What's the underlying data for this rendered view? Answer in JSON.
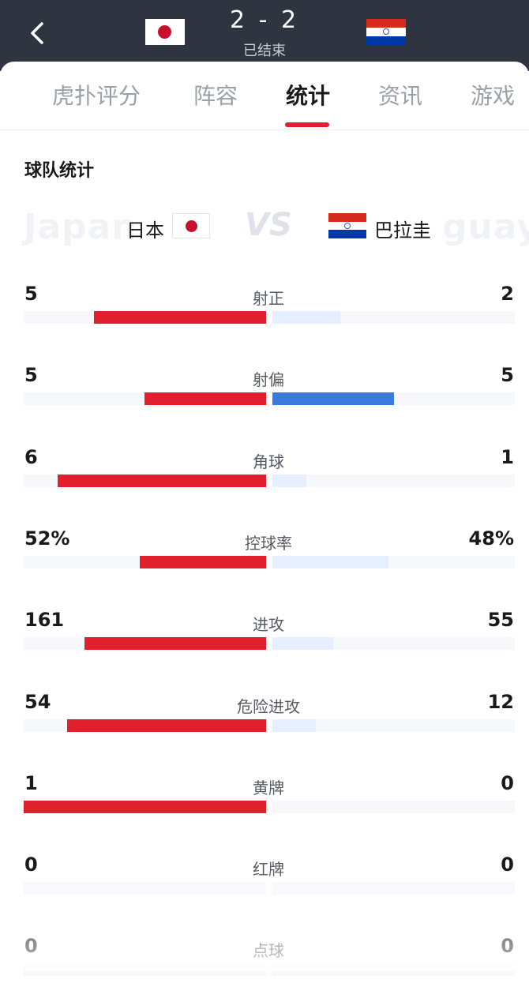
{
  "header": {
    "score": "2 - 2",
    "status": "已结束",
    "home_flag_icon": "japan-flag-icon",
    "away_flag_icon": "paraguay-flag-icon"
  },
  "tabs": [
    {
      "label": "虎扑评分",
      "active": false
    },
    {
      "label": "阵容",
      "active": false
    },
    {
      "label": "统计",
      "active": true
    },
    {
      "label": "资讯",
      "active": false
    },
    {
      "label": "游戏",
      "active": false
    }
  ],
  "section": {
    "title": "球队统计",
    "vs": "VS",
    "home_team": "日本",
    "away_team": "巴拉圭",
    "home_ghost": "Japan",
    "away_ghost": "guay"
  },
  "colors": {
    "accent_red": "#e0202c",
    "accent_blue": "#3b7be0",
    "faded_blue": "#e6efff",
    "header_bg": "#2f3540"
  },
  "stats": [
    {
      "label": "射正",
      "home": "5",
      "away": "2",
      "home_ratio": 0.71,
      "away_ratio": 0.28,
      "winner": "home"
    },
    {
      "label": "射偏",
      "home": "5",
      "away": "5",
      "home_ratio": 0.5,
      "away_ratio": 0.5,
      "winner": "tie"
    },
    {
      "label": "角球",
      "home": "6",
      "away": "1",
      "home_ratio": 0.86,
      "away_ratio": 0.14,
      "winner": "home"
    },
    {
      "label": "控球率",
      "home": "52%",
      "away": "48%",
      "home_ratio": 0.52,
      "away_ratio": 0.48,
      "winner": "home"
    },
    {
      "label": "进攻",
      "home": "161",
      "away": "55",
      "home_ratio": 0.75,
      "away_ratio": 0.25,
      "winner": "home"
    },
    {
      "label": "危险进攻",
      "home": "54",
      "away": "12",
      "home_ratio": 0.82,
      "away_ratio": 0.18,
      "winner": "home"
    },
    {
      "label": "黄牌",
      "home": "1",
      "away": "0",
      "home_ratio": 1.0,
      "away_ratio": 0.0,
      "winner": "home"
    },
    {
      "label": "红牌",
      "home": "0",
      "away": "0",
      "home_ratio": 0.0,
      "away_ratio": 0.0,
      "winner": "none"
    },
    {
      "label": "点球",
      "home": "0",
      "away": "0",
      "home_ratio": 0.0,
      "away_ratio": 0.0,
      "winner": "none"
    }
  ]
}
